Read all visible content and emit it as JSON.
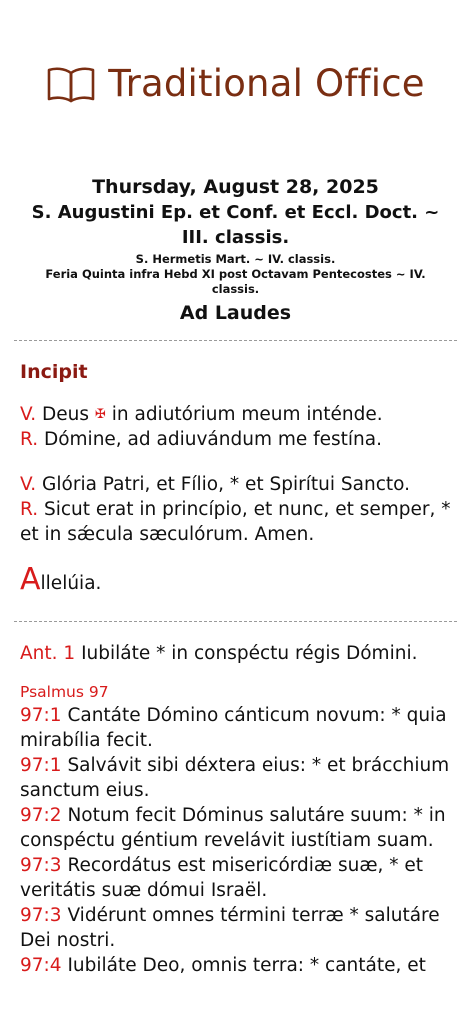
{
  "app": {
    "title": "Traditional Office"
  },
  "office": {
    "date": "Thursday, August 28, 2025",
    "feast_line1": "S. Augustini Ep. et Conf. et Eccl. Doct. ~",
    "feast_line2": "III. classis.",
    "commem1": "S. Hermetis Mart. ~ IV. classis.",
    "commem2_line1": "Feria Quinta infra Hebd XI post Octavam Pentecostes ~ IV.",
    "commem2_line2": "classis.",
    "hour": "Ad Laudes"
  },
  "incipit": {
    "title": "Incipit",
    "v1_marker": "V.",
    "v1_text_a": "Deus",
    "cross": "✠",
    "v1_text_b": "in adiutórium meum inténde.",
    "r1_marker": "R.",
    "r1_text": "Dómine, ad adiuvándum me festína.",
    "v2_marker": "V.",
    "v2_text": "Glória Patri, et Fílio, * et Spirítui Sancto.",
    "r2_marker": "R.",
    "r2_text": "Sicut erat in princípio, et nunc, et semper, * et in sǽcula sæculórum. Amen.",
    "alleluia_initial": "A",
    "alleluia_rest": "llelúia."
  },
  "antiphon": {
    "marker": "Ant. 1",
    "text": "Iubiláte * in conspéctu régis Dómini."
  },
  "psalm": {
    "title": "Psalmus 97",
    "verses": [
      {
        "ref": "97:1",
        "text": "Cantáte Dómino cánticum novum: * quia mirabília fecit."
      },
      {
        "ref": "97:1",
        "text": "Salvávit sibi déxtera eius: * et brácchium sanctum eius."
      },
      {
        "ref": "97:2",
        "text": "Notum fecit Dóminus salutáre suum: * in conspéctu géntium revelávit iustítiam suam."
      },
      {
        "ref": "97:3",
        "text": "Recordátus est misericórdiæ suæ, * et veritátis suæ dómui Israël."
      },
      {
        "ref": "97:3",
        "text": "Vidérunt omnes términi terræ * salutáre Dei nostri."
      },
      {
        "ref": "97:4",
        "text": "Iubiláte Deo, omnis terra: * cantáte, et"
      }
    ]
  },
  "colors": {
    "title": "#7a2e12",
    "rubric": "#d81b1b",
    "section": "#8b1a12"
  },
  "icons": {
    "header": "open-book-icon"
  }
}
